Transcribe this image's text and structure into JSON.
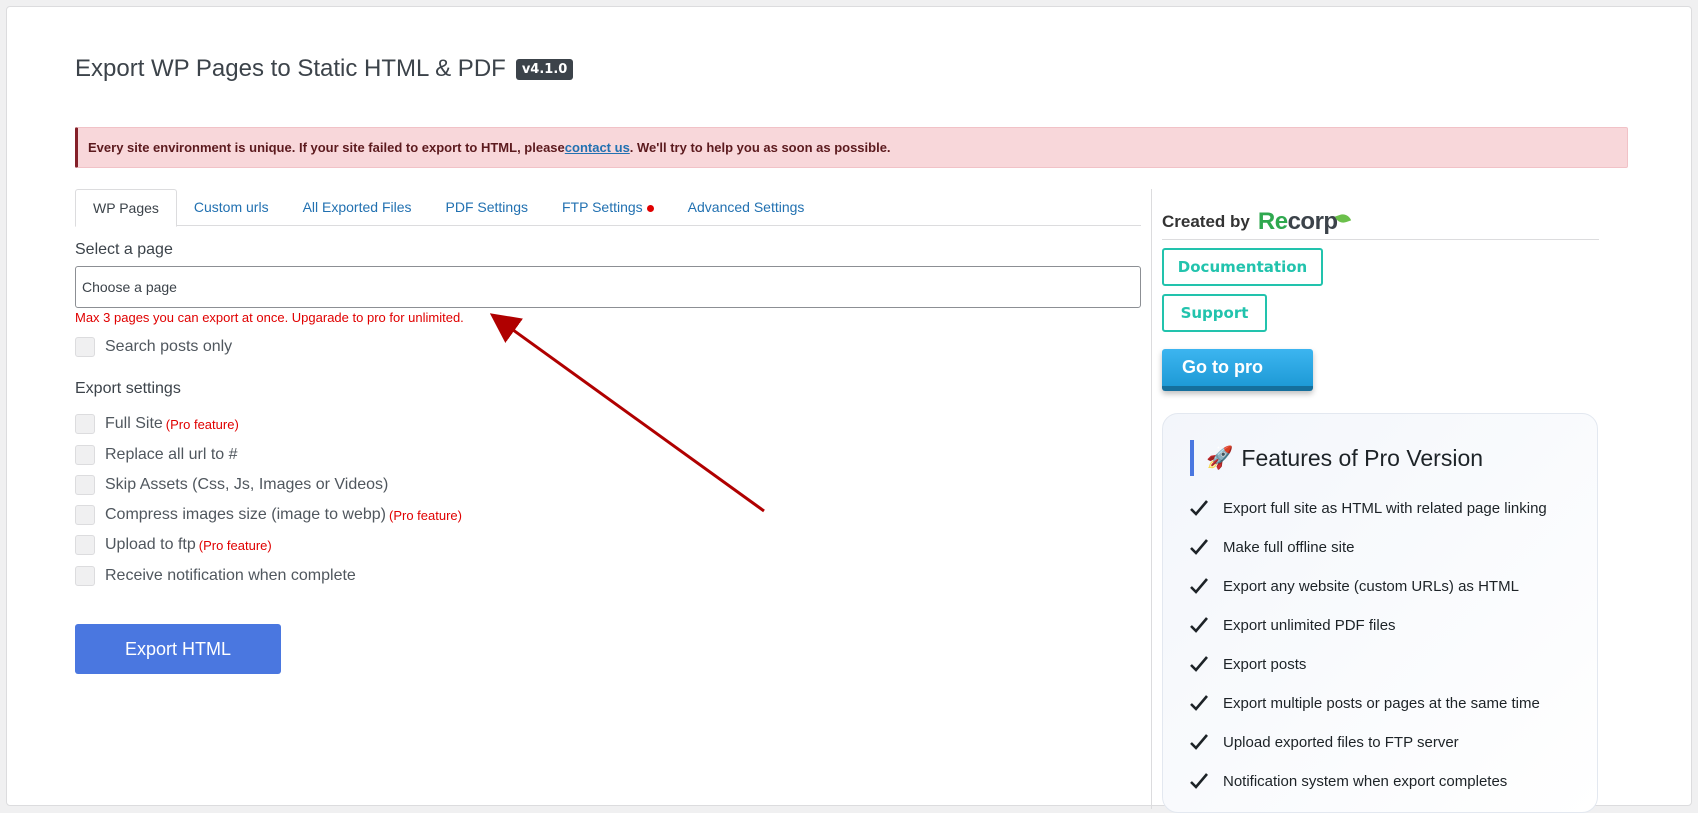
{
  "header": {
    "title": "Export WP Pages to Static HTML & PDF",
    "version": "v4.1.0"
  },
  "notice": {
    "before": "Every site environment is unique. If your site failed to export to HTML, please ",
    "link": "contact us",
    "after": ". We'll try to help you as soon as possible."
  },
  "tabs": [
    {
      "label": "WP Pages",
      "active": true
    },
    {
      "label": "Custom urls"
    },
    {
      "label": "All Exported Files"
    },
    {
      "label": "PDF Settings"
    },
    {
      "label": "FTP Settings",
      "dot": true
    },
    {
      "label": "Advanced Settings"
    }
  ],
  "page_select": {
    "label": "Select a page",
    "placeholder": "Choose a page",
    "limit_message": "Max 3 pages you can export at once. Upgarade to pro for unlimited."
  },
  "search_posts": "Search posts only",
  "export_settings": {
    "heading": "Export settings",
    "options": [
      {
        "label": "Full Site",
        "pro": "(Pro feature)"
      },
      {
        "label": "Replace all url to #"
      },
      {
        "label": "Skip Assets (Css, Js, Images or Videos)"
      },
      {
        "label": "Compress images size (image to webp)",
        "pro": "(Pro feature)"
      },
      {
        "label": "Upload to ftp",
        "pro": "(Pro feature)"
      },
      {
        "label": "Receive notification when complete"
      }
    ]
  },
  "export_button": "Export HTML",
  "sidebar": {
    "created_by": "Created by",
    "logo_green": "Re",
    "logo_dark": "corp",
    "documentation": "Documentation",
    "support": "Support",
    "go_pro": "Go to pro",
    "features_title": "Features of Pro Version",
    "features": [
      "Export full site as HTML with related page linking",
      "Make full offline site",
      "Export any website (custom URLs) as HTML",
      "Export unlimited PDF files",
      "Export posts",
      "Export multiple posts or pages at the same time",
      "Upload exported files to FTP server",
      "Notification system when export completes"
    ]
  },
  "colors": {
    "primary_button": "#4a77e0",
    "accent_teal": "#22c3ad",
    "notice_bg": "#f8d7da",
    "link": "#2271b1",
    "error": "#e00000"
  }
}
